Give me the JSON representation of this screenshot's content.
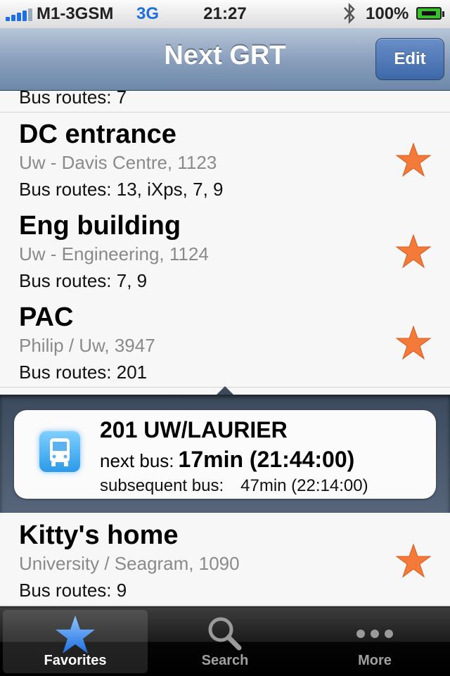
{
  "status_bar": {
    "carrier": "M1-3GSM",
    "network": "3G",
    "time": "21:27",
    "battery": "100%"
  },
  "nav": {
    "title": "Next GRT",
    "edit_label": "Edit"
  },
  "list": {
    "partial_row_routes": "Bus routes: 7",
    "stops": [
      {
        "name": "DC entrance",
        "subtitle": "Uw - Davis Centre, 1123",
        "routes": "Bus routes: 13, iXps, 7, 9"
      },
      {
        "name": "Eng building",
        "subtitle": "Uw - Engineering, 1124",
        "routes": "Bus routes: 7, 9"
      },
      {
        "name": "PAC",
        "subtitle": "Philip / Uw, 3947",
        "routes": "Bus routes: 201"
      },
      {
        "name": "Kitty's home",
        "subtitle": "University / Seagram, 1090",
        "routes": "Bus routes: 9"
      }
    ]
  },
  "detail": {
    "route_title": "201 UW/LAURIER",
    "next_label": "next bus:",
    "next_value": "17min (21:44:00)",
    "subsequent_label": "subsequent bus:",
    "subsequent_value": "47min (22:14:00)"
  },
  "tabs": [
    {
      "label": "Favorites",
      "icon": "star-icon",
      "active": true
    },
    {
      "label": "Search",
      "icon": "search-icon",
      "active": false
    },
    {
      "label": "More",
      "icon": "more-icon",
      "active": false
    }
  ],
  "colors": {
    "star": "#f47a3a",
    "nav_bar": "#7f97b6",
    "edit_button": "#4a74b3",
    "tab_active_star": "#3b8ef0"
  }
}
